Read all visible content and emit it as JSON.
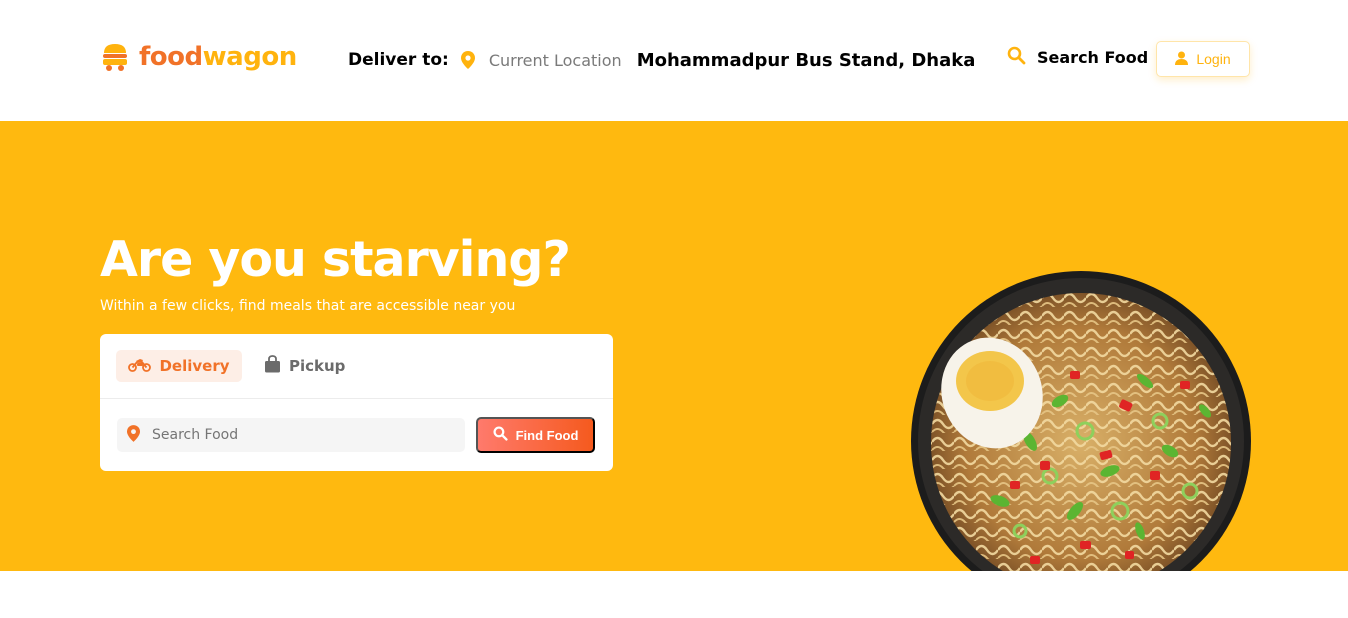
{
  "brand": {
    "part1": "food",
    "part2": "wagon",
    "icon": "food-truck-icon"
  },
  "header": {
    "deliver_label": "Deliver to:",
    "location_icon": "map-pin-icon",
    "current_location": "Current Location",
    "address": "Mohammadpur Bus Stand, Dhaka",
    "search_icon": "search-icon",
    "search_label": "Search Food",
    "login_icon": "user-icon",
    "login_label": "Login"
  },
  "hero": {
    "title": "Are you starving?",
    "subtitle": "Within a few clicks, find meals that are accessible near you",
    "image": "noodle-bowl-image"
  },
  "order_card": {
    "tabs": [
      {
        "label": "Delivery",
        "icon": "motorcycle-icon",
        "active": true
      },
      {
        "label": "Pickup",
        "icon": "shopping-bag-icon",
        "active": false
      }
    ],
    "search": {
      "icon": "map-pin-icon",
      "placeholder": "Search Food",
      "value": ""
    },
    "find_button": {
      "icon": "search-icon",
      "label": "Find Food"
    }
  },
  "colors": {
    "brand_orange": "#f17228",
    "brand_yellow": "#ffb30e",
    "hero_background": "#ffb90f",
    "button_gradient_start": "#ff7a6c",
    "button_gradient_end": "#f55a1e"
  }
}
